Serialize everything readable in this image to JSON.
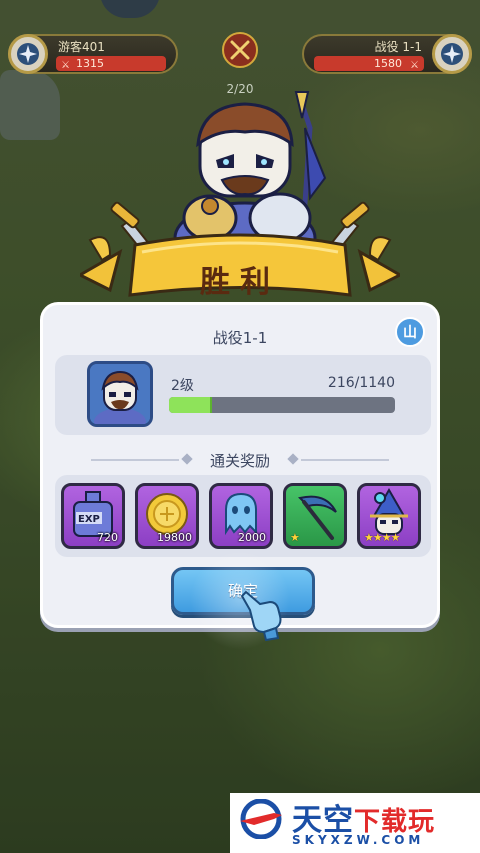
{
  "top_bar": {
    "player": {
      "name": "游客401",
      "power": "1315"
    },
    "enemy": {
      "name": "战役 1-1",
      "power": "1580"
    },
    "wave_counter": "2/20"
  },
  "banner": {
    "title": "胜利"
  },
  "panel": {
    "stage_title": "战役1-1",
    "mountain_button": "山",
    "hero": {
      "level_label": "2级",
      "exp_text": "216/1140",
      "exp_fraction": 0.19
    },
    "rewards_title": "通关奖励",
    "rewards": [
      {
        "icon": "exp-potion-icon",
        "count": "720",
        "color": "#9a4ad2"
      },
      {
        "icon": "gold-coin-icon",
        "count": "19800",
        "color": "#9a4ad2"
      },
      {
        "icon": "ghost-soul-icon",
        "count": "2000",
        "color": "#9a4ad2"
      },
      {
        "icon": "scythe-weapon-icon",
        "stars": 1,
        "color": "#35ad58"
      },
      {
        "icon": "wizard-hero-icon",
        "stars": 4,
        "color": "#9a4ad2"
      }
    ],
    "confirm_label": "确定"
  },
  "watermark": {
    "title_blue": "天空",
    "title_red": "下载玩",
    "subtitle": "SKYXZW.COM"
  },
  "colors": {
    "confirm_button": "#4aa8e8",
    "exp_fill": "#8ee35a",
    "panel_bg": "#eef0f6",
    "banner_gold": "#f5c63a"
  }
}
